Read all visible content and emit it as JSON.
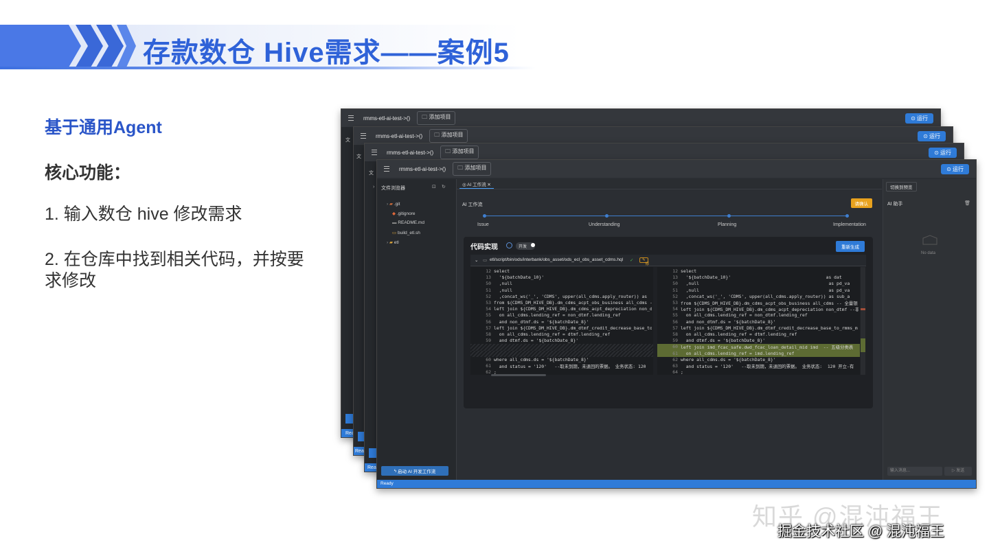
{
  "slide": {
    "title": "存款数仓 Hive需求——案例5",
    "subtitle": "基于通用Agent",
    "core_label": "核心功能：",
    "items": [
      "1. 输入数仓 hive 修改需求",
      "2. 在仓库中找到相关代码，并按要求修改"
    ]
  },
  "app": {
    "project": "rmms-etl-ai-test->()",
    "add_project": "添加项目",
    "run": "运行",
    "file_browser": "文件浏览器",
    "files_stub": "文",
    "tree": [
      ".git",
      ".gitignore",
      "README.md",
      "build_etl.sh",
      "etl"
    ],
    "start_workflow": "启动 AI 开发工作流",
    "status": "Ready",
    "status_stub": "Read",
    "tab": "AI 工作流",
    "workflow_title": "AI 工作流",
    "confirm_button": "请确认",
    "steps": [
      "Issue",
      "Understanding",
      "Planning",
      "Implementation"
    ],
    "code_title": "代码实现",
    "toggle": "开发",
    "regenerate": "重新生成",
    "file_path": "etl/script/bin/ods/interbank/obs_asset/ods_ecl_obs_asset_cdms.hql",
    "modified_tag": "修改",
    "switch_preview": "切换到预览",
    "assistant_title": "AI 助手",
    "no_data": "No data",
    "input_placeholder": "输入消息...",
    "send": "发送"
  },
  "code_left": [
    {
      "n": "12",
      "t": "select"
    },
    {
      "n": "13",
      "t": "  '${batchDate_10}'"
    },
    {
      "n": "50",
      "t": "  ,null"
    },
    {
      "n": "51",
      "t": "  ,null"
    },
    {
      "n": "52",
      "t": "  ,concat_ws('_', 'CDMS', upper(all_cdms.apply_router)) as"
    },
    {
      "n": "53",
      "t": "from ${CDMS_DM_HIVE_DB}.dm_cdms_acpt_obs_business all_cdms --"
    },
    {
      "n": "54",
      "t": "left join ${CDMS_DM_HIVE_DB}.dm_cdms_acpt_depreciation non_dt"
    },
    {
      "n": "55",
      "t": "  on all_cdms.lending_ref = non_dtmf.lending_ref"
    },
    {
      "n": "56",
      "t": "  and non_dtmf.ds = '${batchDate_8}'"
    },
    {
      "n": "57",
      "t": "left join ${CDMS_DM_HIVE_DB}.dm_dtmf_credit_decrease_base_to_"
    },
    {
      "n": "58",
      "t": "  on all_cdms.lending_ref = dtmf.lending_ref"
    },
    {
      "n": "59",
      "t": "  and dtmf.ds = '${batchDate_8}'"
    },
    {
      "n": "",
      "t": ""
    },
    {
      "n": "",
      "t": ""
    },
    {
      "n": "60",
      "t": "where all_cdms.ds = '${batchDate_8}'"
    },
    {
      "n": "61",
      "t": "  and status = '120'   --取未到期，未退回的票据。 业务状态: 120"
    },
    {
      "n": "62",
      "t": ";"
    }
  ],
  "code_right": [
    {
      "n": "12",
      "t": "select"
    },
    {
      "n": "13",
      "t": "  '${batchDate_10}'                                    as dat"
    },
    {
      "n": "50",
      "t": "  ,null                                                 as pd_va"
    },
    {
      "n": "51",
      "t": "  ,null                                                 as pd_va"
    },
    {
      "n": "52",
      "t": "  ,concat_ws('_', 'CDMS', upper(all_cdms.apply_router)) as sub_a"
    },
    {
      "n": "53",
      "t": "from ${CDMS_DM_HIVE_DB}.dm_cdms_acpt_obs_business all_cdms -- 全量银"
    },
    {
      "n": "54",
      "t": "left join ${CDMS_DM_HIVE_DB}.dm_cdms_acpt_depreciation non_dtmf --非"
    },
    {
      "n": "55",
      "t": "  on all_cdms.lending_ref = non_dtmf.lending_ref"
    },
    {
      "n": "56",
      "t": "  and non_dtmf.ds = '${batchDate_8}'"
    },
    {
      "n": "57",
      "t": "left join ${CDMS_DM_HIVE_DB}.dm_dtmf_credit_decrease_base_to_rmms_m"
    },
    {
      "n": "58",
      "t": "  on all_cdms.lending_ref = dtmf.lending_ref"
    },
    {
      "n": "59",
      "t": "  and dtmf.ds = '${batchDate_8}'"
    },
    {
      "n": "60",
      "t": "left join imd_fcac_safe.dwd_fcac_loan_detail_mid imd  -- 五级分类表"
    },
    {
      "n": "61",
      "t": "  on all_cdms.lending_ref = imd.lending_ref"
    },
    {
      "n": "62",
      "t": "where all_cdms.ds = '${batchDate_8}'"
    },
    {
      "n": "63",
      "t": "  and status = '120'   --取未到期，未退回的票据。 业务状态:  120 开立-有"
    },
    {
      "n": "64",
      "t": ";"
    }
  ],
  "watermark": {
    "line1": "知乎 @混沌福王",
    "line2": "掘金技术社区 @ 混沌福王"
  },
  "colors": {
    "accent": "#2f62d8",
    "app_blue": "#2f7bd8",
    "confirm": "#e8a21e",
    "added_line": "#5d6b33"
  }
}
